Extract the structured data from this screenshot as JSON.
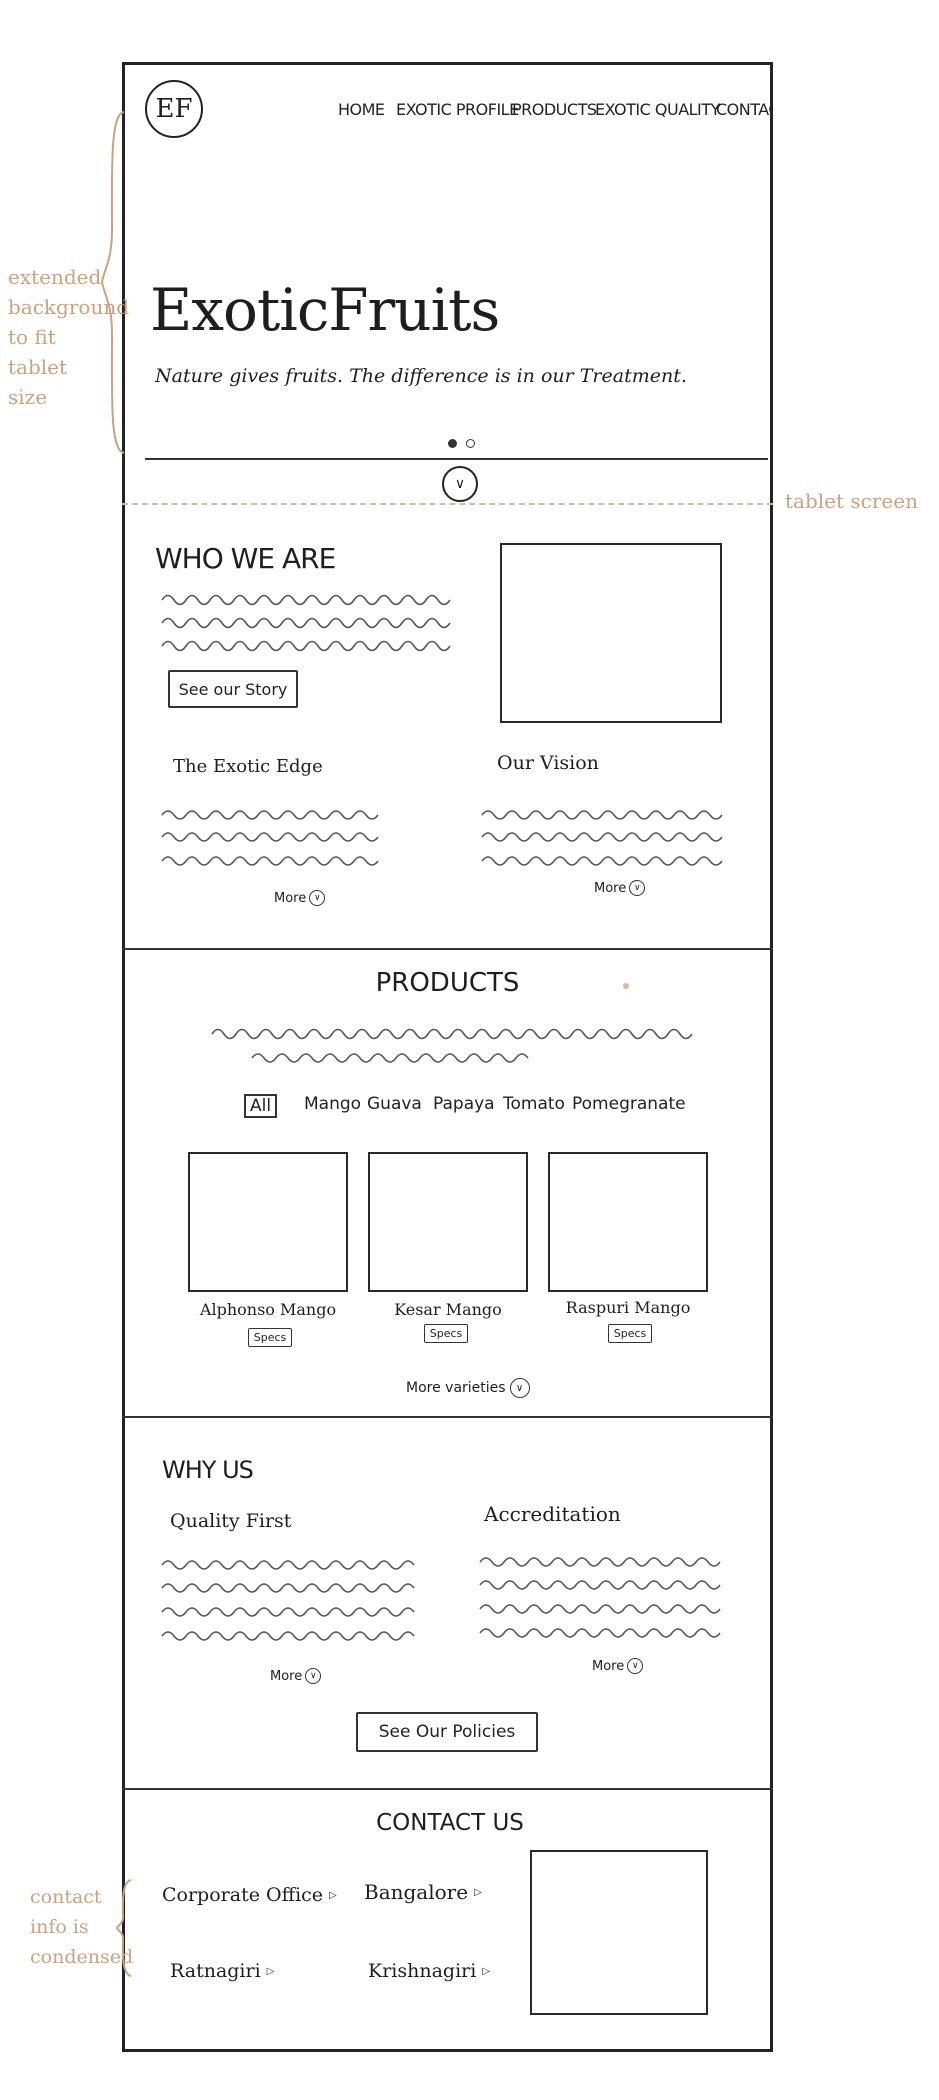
{
  "brand": {
    "logo_text": "EF"
  },
  "nav": {
    "items": [
      "HOME",
      "EXOTIC PROFILE",
      "PRODUCTS",
      "EXOTIC QUALITY",
      "CONTACT"
    ]
  },
  "hero": {
    "title": "ExoticFruits",
    "tagline": "Nature gives fruits. The difference is in our Treatment."
  },
  "annotations": {
    "extended": "extended background to fit tablet size",
    "tablet": "tablet screen",
    "contact": "contact info is condensed"
  },
  "who": {
    "heading": "WHO WE ARE",
    "cta": "See our Story",
    "edge_title": "The Exotic Edge",
    "vision_title": "Our Vision",
    "more": "More"
  },
  "products": {
    "heading": "PRODUCTS",
    "filters": [
      "All",
      "Mango",
      "Guava",
      "Papaya",
      "Tomato",
      "Pomegranate"
    ],
    "items": [
      {
        "name": "Alphonso Mango",
        "specs": "Specs"
      },
      {
        "name": "Kesar Mango",
        "specs": "Specs"
      },
      {
        "name": "Raspuri Mango",
        "specs": "Specs"
      }
    ],
    "more_varieties": "More varieties"
  },
  "why": {
    "heading": "WHY US",
    "quality_title": "Quality First",
    "accreditation_title": "Accreditation",
    "more": "More",
    "cta": "See Our Policies"
  },
  "contact": {
    "heading": "CONTACT US",
    "locations": [
      "Corporate Office",
      "Bangalore",
      "Ratnagiri",
      "Krishnagiri"
    ]
  }
}
